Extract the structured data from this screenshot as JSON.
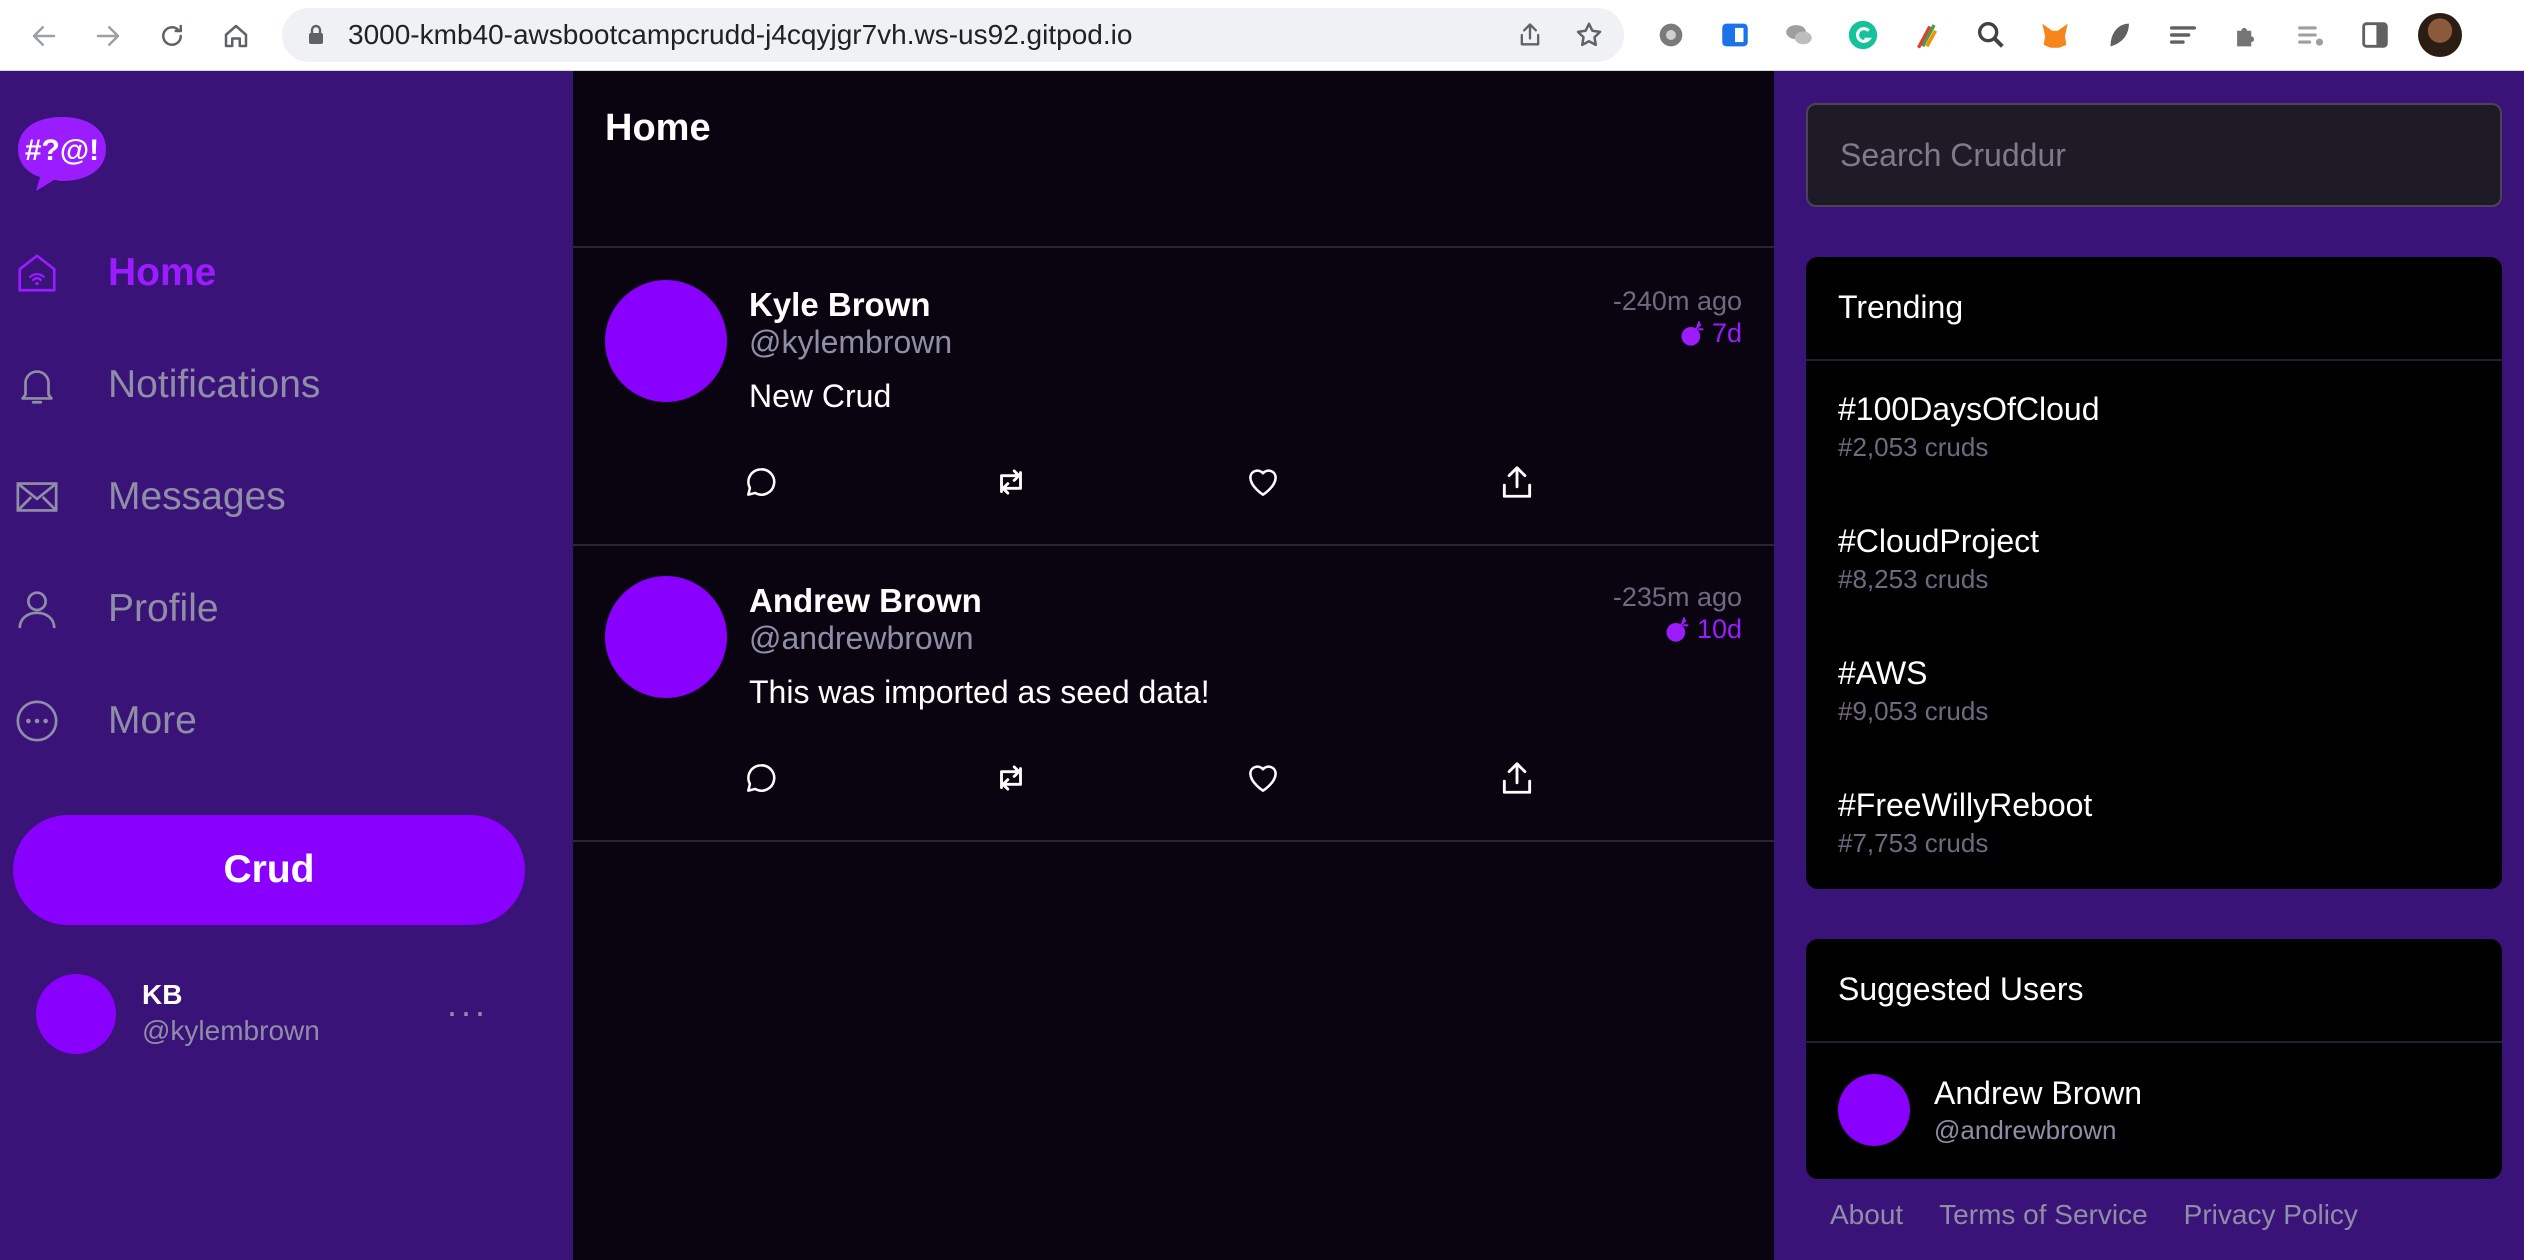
{
  "browser": {
    "url": "3000-kmb40-awsbootcampcrudd-j4cqyjgr7vh.ws-us92.gitpod.io"
  },
  "sidebar": {
    "logo_text": "#?@!",
    "nav": [
      {
        "label": "Home",
        "icon": "home-icon",
        "active": true
      },
      {
        "label": "Notifications",
        "icon": "bell-icon",
        "active": false
      },
      {
        "label": "Messages",
        "icon": "envelope-icon",
        "active": false
      },
      {
        "label": "Profile",
        "icon": "person-icon",
        "active": false
      },
      {
        "label": "More",
        "icon": "more-circle-icon",
        "active": false
      }
    ],
    "crud_button": "Crud",
    "profile": {
      "name": "KB",
      "handle": "@kylembrown",
      "more": "···"
    }
  },
  "main": {
    "title": "Home",
    "activities": [
      {
        "name": "Kyle Brown",
        "handle": "@kylembrown",
        "message": "New Crud",
        "time": "-240m ago",
        "expires": "7d"
      },
      {
        "name": "Andrew Brown",
        "handle": "@andrewbrown",
        "message": "This was imported as seed data!",
        "time": "-235m ago",
        "expires": "10d"
      }
    ]
  },
  "right": {
    "search_placeholder": "Search Cruddur",
    "trending": {
      "title": "Trending",
      "items": [
        {
          "name": "#100DaysOfCloud",
          "count": "#2,053 cruds"
        },
        {
          "name": "#CloudProject",
          "count": "#8,253 cruds"
        },
        {
          "name": "#AWS",
          "count": "#9,053 cruds"
        },
        {
          "name": "#FreeWillyReboot",
          "count": "#7,753 cruds"
        }
      ]
    },
    "suggested": {
      "title": "Suggested Users",
      "users": [
        {
          "name": "Andrew Brown",
          "handle": "@andrewbrown"
        }
      ]
    },
    "footer": [
      "About",
      "Terms of Service",
      "Privacy Policy"
    ]
  },
  "colors": {
    "accent": "#8900ff",
    "sidebar_bg": "#3a1378",
    "feed_bg": "#0a0410",
    "muted": "#8e8ea6"
  }
}
